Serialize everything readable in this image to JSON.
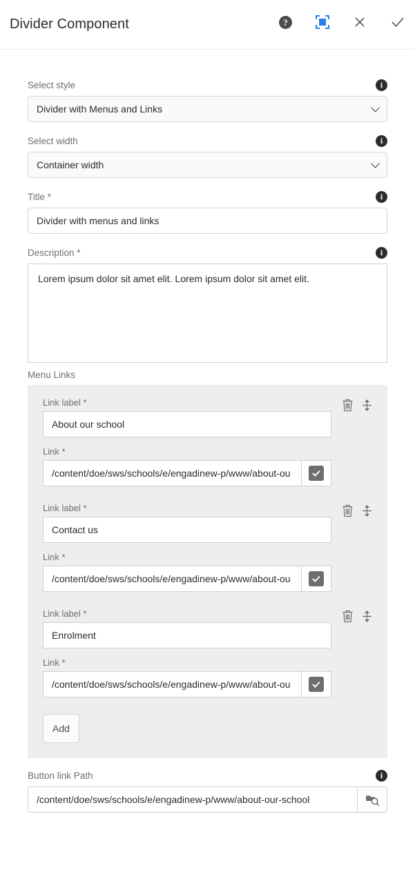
{
  "header": {
    "title": "Divider Component",
    "help_icon": "help-circle-icon",
    "fullscreen_icon": "fullscreen-icon",
    "close_label": "✕",
    "confirm_label": "✓"
  },
  "fields": {
    "select_style": {
      "label": "Select style",
      "value": "Divider with Menus and Links",
      "info_glyph": "i"
    },
    "select_width": {
      "label": "Select width",
      "value": "Container width",
      "info_glyph": "i"
    },
    "title": {
      "label": "Title *",
      "value": "Divider with menus and links",
      "info_glyph": "i"
    },
    "description": {
      "label": "Description *",
      "value": "Lorem ipsum dolor sit amet elit. Lorem ipsum dolor sit amet elit.",
      "info_glyph": "i"
    },
    "button_link_path": {
      "label": "Button link Path",
      "value": "/content/doe/sws/schools/e/engadinew-p/www/about-our-school",
      "info_glyph": "i",
      "browse_icon": "folder-search-icon"
    }
  },
  "menu_links": {
    "section_label": "Menu Links",
    "link_label_caption": "Link label *",
    "link_caption": "Link *",
    "add_label": "Add",
    "items": [
      {
        "label": "About our school",
        "link": "/content/doe/sws/schools/e/engadinew-p/www/about-ou",
        "checked": true
      },
      {
        "label": "Contact us",
        "link": "/content/doe/sws/schools/e/engadinew-p/www/about-ou",
        "checked": true
      },
      {
        "label": "Enrolment",
        "link": "/content/doe/sws/schools/e/engadinew-p/www/about-ou",
        "checked": true
      }
    ]
  },
  "colors": {
    "accent_blue": "#2680eb",
    "panel_gray": "#eeeeee",
    "icon_gray": "#6e6e6e",
    "text_dark": "#2b2b2b"
  }
}
